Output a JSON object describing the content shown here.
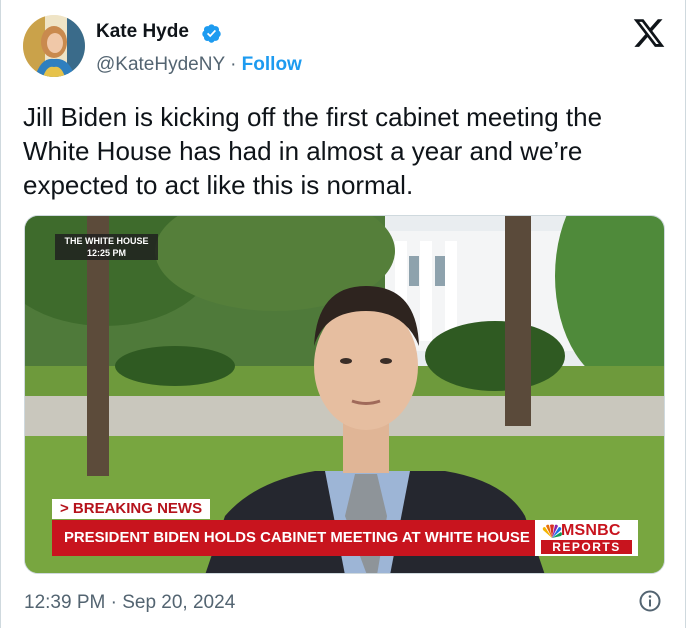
{
  "author": {
    "name": "Kate Hyde",
    "handle": "@KateHydeNY",
    "separator": "·",
    "follow_label": "Follow",
    "verified": true
  },
  "tweet": {
    "text": "Jill Biden is kicking off the first cabinet meeting the White House has had in almost a year and we’re expected to act like this is normal.",
    "timestamp": "12:39 PM · Sep 20, 2024"
  },
  "media": {
    "location_bug": "THE WHITE HOUSE",
    "time_bug": "12:25 PM",
    "breaking_label": "> BREAKING NEWS",
    "headline": "PRESIDENT BIDEN HOLDS CABINET MEETING AT WHITE HOUSE",
    "network": "MSNBC",
    "network_segment": "REPORTS"
  },
  "icons": {
    "platform_logo": "x-logo-icon",
    "verified": "verified-badge-icon",
    "info": "info-icon"
  },
  "colors": {
    "follow": "#1d9bf0",
    "verified": "#1d9bf0",
    "secondary_text": "#536471",
    "headline_bar": "#c8141e"
  }
}
